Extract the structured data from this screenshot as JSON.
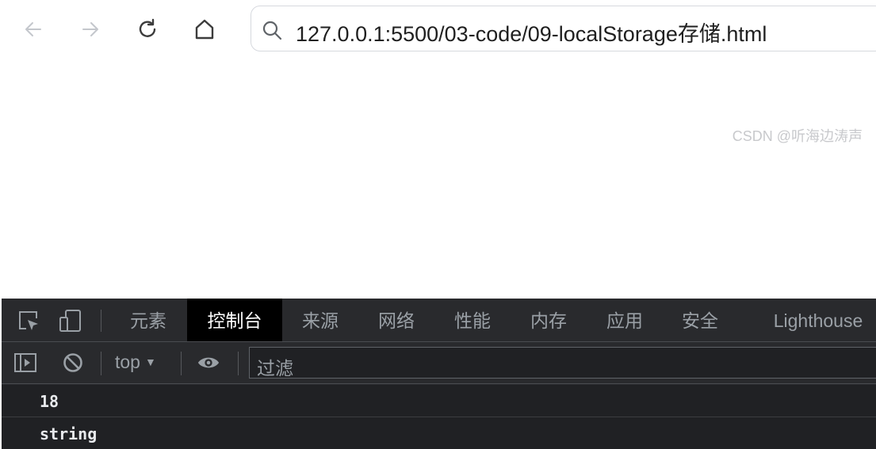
{
  "browser": {
    "url": "127.0.0.1:5500/03-code/09-localStorage存储.html",
    "icons": [
      "back-icon",
      "forward-icon",
      "reload-icon",
      "home-icon",
      "search-icon"
    ]
  },
  "devtools": {
    "tabs": [
      "元素",
      "控制台",
      "来源",
      "网络",
      "性能",
      "内存",
      "应用",
      "安全",
      "Lighthouse"
    ],
    "active_tab": "控制台",
    "context": "top",
    "filter_placeholder": "过滤",
    "logs": [
      "18",
      "string"
    ]
  },
  "watermark": "CSDN @听海边涛声",
  "colors": {
    "devtools_bg": "#292a2d",
    "console_bg": "#202124",
    "active_tab_bg": "#000000",
    "text_light": "#e8eaed",
    "text_muted": "#9aa0a6"
  }
}
